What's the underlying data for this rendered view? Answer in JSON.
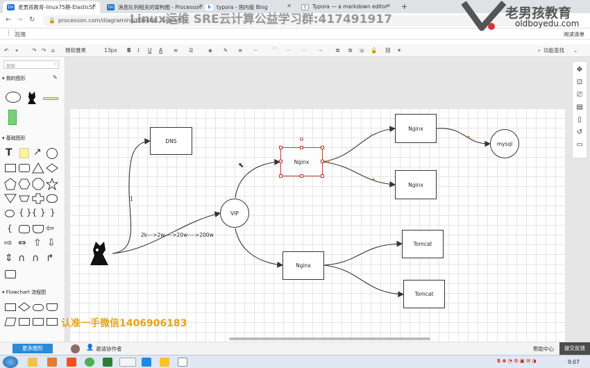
{
  "browser": {
    "tabs": [
      {
        "label": "老男孩教育-linux75期-ElasticSt",
        "fav": "Do",
        "active": true
      },
      {
        "label": "消息队列相关的架构图 - Processon",
        "fav": "Do",
        "active": false
      },
      {
        "label": "typora - 国内版 Bing",
        "fav": "b",
        "active": false
      },
      {
        "label": "Typora — a markdown editor",
        "fav": "T",
        "active": false
      }
    ],
    "new_tab": "+",
    "url": "processon.com/diagraming/60a6b6...3eb/e97c",
    "apps_label": "应用",
    "reading_list": "阅读清单"
  },
  "watermark": {
    "top": "Linux运维 SRE云计算公益学习群:417491917",
    "bottom": "认准一手微信1406906183",
    "logo_cn": "老男孩教育",
    "logo_url": "oldboyedu.com"
  },
  "toolbar": {
    "font": "微软雅黑",
    "size": "13px",
    "bold": "B",
    "italic": "I",
    "underline": "U",
    "fontcolor": "A",
    "feature_search": "功能查找"
  },
  "left_panel": {
    "search_placeholder": "搜索",
    "my_shapes": "我的图形",
    "basic_shapes": "基础图形",
    "flowchart": "Flowchart 流程图",
    "more_shapes": "更多图形"
  },
  "diagram": {
    "dns": "DNS",
    "vip": "VIP",
    "nginx_mid": "Nginx",
    "nginx_top": "Nginx",
    "nginx_mid2": "Nginx",
    "nginx_bottom": "Nginx",
    "mysql": "mysql",
    "tomcat1": "Tomcat",
    "tomcat2": "Tomcat",
    "label_1": "1",
    "label_traffic": "2k--->2w---->20w---->200w"
  },
  "bottom": {
    "invite": "邀请协作者",
    "help": "帮助中心",
    "feedback": "提交反馈"
  },
  "taskbar": {
    "time": "9:07"
  },
  "colors": {
    "accent": "#1e72c9",
    "feedback_bg": "#4c4c4c",
    "more_shapes_bg": "#2a8cd8",
    "handle": "#c0392b",
    "watermark_orange": "#e8a317"
  }
}
